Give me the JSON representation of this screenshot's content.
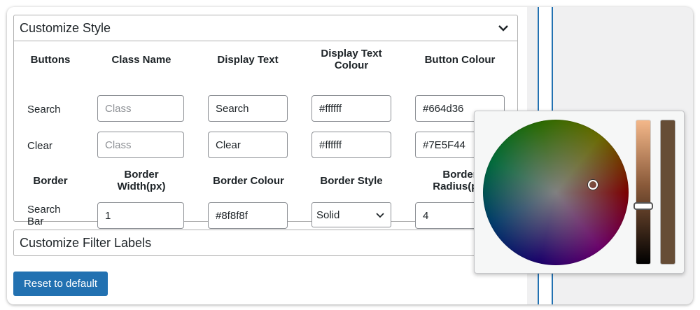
{
  "accent_color": "#2271b1",
  "customize_style": {
    "title": "Customize Style",
    "icon": "chevron-down-icon",
    "headers": {
      "buttons": "Buttons",
      "class_name": "Class Name",
      "display_text": "Display Text",
      "display_text_colour_line1": "Display Text",
      "display_text_colour_line2": "Colour",
      "button_colour": "Button Colour"
    },
    "rows": [
      {
        "label": "Search",
        "class_placeholder": "Class",
        "display_text": "Search",
        "text_colour": "#ffffff",
        "button_colour": "#664d36"
      },
      {
        "label": "Clear",
        "class_placeholder": "Class",
        "display_text": "Clear",
        "text_colour": "#ffffff",
        "button_colour": "#7E5F44"
      }
    ],
    "border_headers": {
      "border": "Border",
      "border_width_line1": "Border",
      "border_width_line2": "Width(px)",
      "border_colour": "Border Colour",
      "border_style": "Border Style",
      "border_radius_line1": "Border",
      "border_radius_line2": "Radius(px)"
    },
    "border_row": {
      "label_line1": "Search",
      "label_line2": "Bar",
      "width": "1",
      "colour": "#8f8f8f",
      "style": "Solid",
      "radius": "4"
    }
  },
  "customize_filter_labels": {
    "title": "Customize Filter Labels"
  },
  "reset_button": "Reset to default",
  "color_picker": {
    "current_color": "#664d36"
  }
}
